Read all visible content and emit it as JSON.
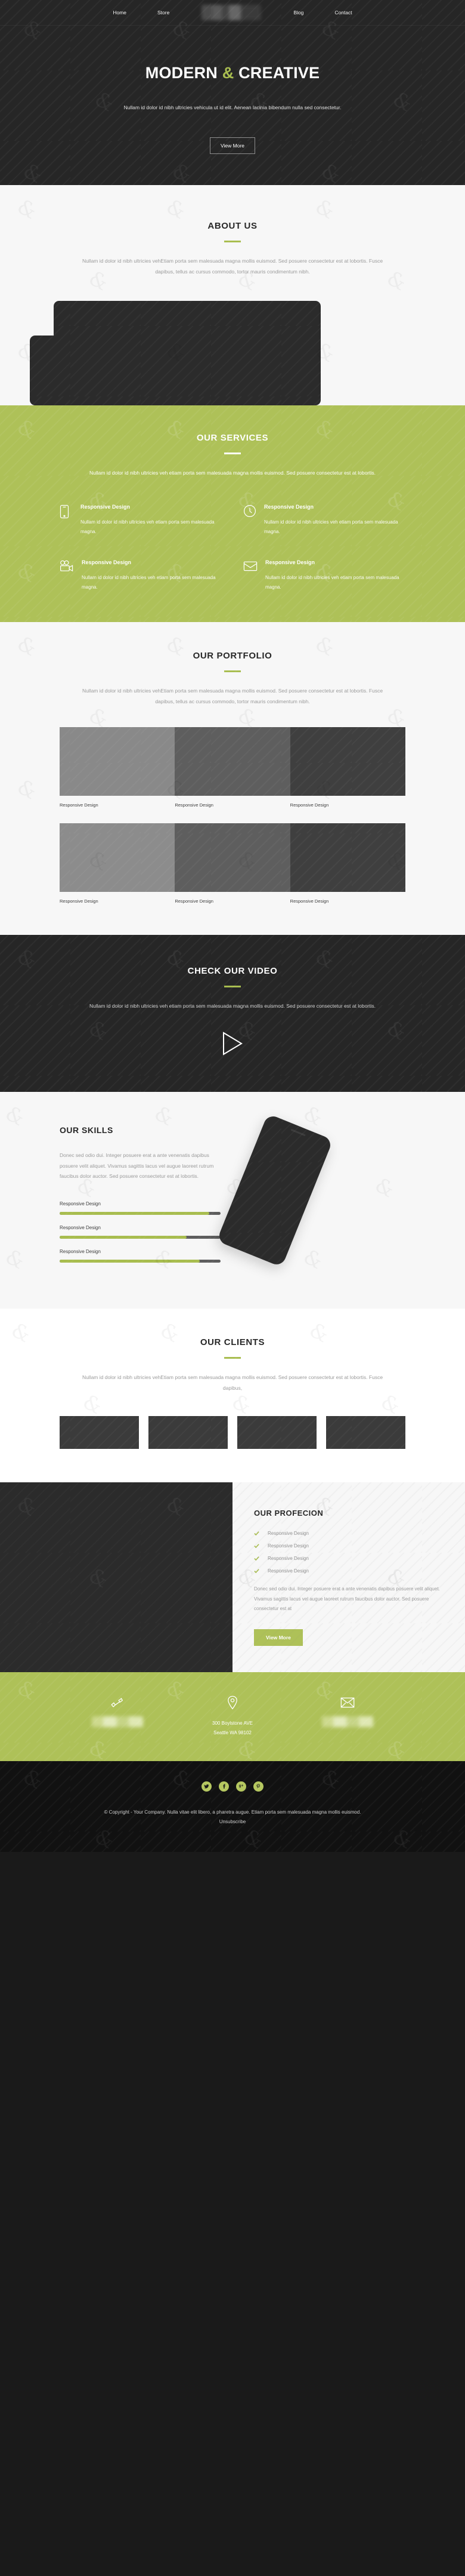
{
  "brand": {
    "accent": "#a8bd4f",
    "green_bg": "#aec158",
    "dark_bg": "#262626",
    "light_bg": "#f7f7f7"
  },
  "nav": {
    "left": [
      {
        "label": "Home"
      },
      {
        "label": "Store"
      }
    ],
    "right": [
      {
        "label": "Blog"
      },
      {
        "label": "Contact"
      }
    ],
    "logo_alt": "logo-blurred"
  },
  "hero": {
    "title_part1": "MODERN",
    "title_amp": "&",
    "title_part2": "CREATIVE",
    "subtitle": "Nullam id dolor id nibh ultricies vehicula ut id elit. Aenean lacinia bibendum nulla sed consectetur.",
    "cta": "View More"
  },
  "about": {
    "title": "ABOUT US",
    "body": "Nullam id dolor id nibh ultricies vehEtiam porta sem malesuada magna mollis euismod. Sed posuere consectetur est at lobortis. Fusce dapibus, tellus ac cursus commodo, tortor mauris condimentum nibh."
  },
  "services": {
    "title": "OUR SERVICES",
    "body": "Nullam id dolor id nibh ultricies veh etiam porta sem malesuada magna mollis euismod. Sed posuere consectetur est at lobortis.",
    "items": [
      {
        "icon": "mobile-icon",
        "heading": "Responsive Design",
        "text": "Nullam id dolor id nibh ultricies veh etiam porta sem malesuada magna."
      },
      {
        "icon": "clock-icon",
        "heading": "Responsive Design",
        "text": "Nullam id dolor id nibh ultricies veh etiam porta sem malesuada magna."
      },
      {
        "icon": "video-camera-icon",
        "heading": "Responsive Design",
        "text": "Nullam id dolor id nibh ultricies veh etiam porta sem malesuada magna."
      },
      {
        "icon": "envelope-icon",
        "heading": "Responsive Design",
        "text": "Nullam id dolor id nibh ultricies veh etiam porta sem malesuada magna."
      }
    ]
  },
  "portfolio": {
    "title": "OUR PORTFOLIO",
    "body": "Nullam id dolor id nibh ultricies vehEtiam porta sem malesuada magna mollis euismod. Sed posuere consectetur est at lobortis. Fusce dapibus, tellus ac cursus commodo, tortor mauris condimentum nibh.",
    "row1": [
      {
        "caption": "Responsive Design",
        "color": "#898989"
      },
      {
        "caption": "Responsive Design",
        "color": "#5e5e5e"
      },
      {
        "caption": "Responsive Design",
        "color": "#3f3f3f"
      }
    ],
    "row2": [
      {
        "caption": "Responsive Design",
        "color": "#8c8c8c"
      },
      {
        "caption": "Responsive Design",
        "color": "#5e5e5e"
      },
      {
        "caption": "Responsive Design",
        "color": "#3f3f3f"
      }
    ]
  },
  "video": {
    "title": "CHECK OUR VIDEO",
    "body": "Nullam id dolor id nibh ultricies veh etiam porta sem malesuada magna mollis euismod. Sed posuere consectetur est at lobortis.",
    "play_label": "play-button"
  },
  "skills": {
    "title": "OUR SKILLS",
    "body": "Donec sed odio dui. Integer posuere erat a ante venenatis dapibus posuere velit aliquet. Vivamus sagittis lacus vel augue laoreet rutrum faucibus dolor auctor. Sed posuere consectetur est at lobortis.",
    "bars": [
      {
        "label": "Responsive Design",
        "percent": 93
      },
      {
        "label": "Responsive Design",
        "percent": 79
      },
      {
        "label": "Responsive Design",
        "percent": 87
      }
    ]
  },
  "clients": {
    "title": "OUR CLIENTS",
    "body": "Nullam id dolor id nibh ultricies vehEtiam porta sem malesuada magna mollis euismod. Sed posuere consectetur est at lobortis. Fusce dapibus,",
    "logos": [
      {
        "name": "client-logo-1"
      },
      {
        "name": "client-logo-2"
      },
      {
        "name": "client-logo-3"
      },
      {
        "name": "client-logo-4"
      }
    ]
  },
  "profecion": {
    "title": "OUR PROFECION",
    "list": [
      {
        "label": "Responsive Design"
      },
      {
        "label": "Responsive Design"
      },
      {
        "label": "Responsive Design"
      },
      {
        "label": "Responsive Design"
      }
    ],
    "body": "Donec sed odio dui. Integer posuere erat a ante venenatis dapibus posuere velit aliquet. Vivamus sagittis lacus vel augue laoreet rutrum faucibus dolor auctor. Sed posuere consectetur est at",
    "cta": "View More"
  },
  "contact": {
    "phone": {
      "icon": "phone-icon",
      "value": ""
    },
    "address": {
      "icon": "location-pin-icon",
      "line1": "300 Boylstone AVE",
      "line2": "Seattle WA 98102"
    },
    "email": {
      "icon": "envelope-icon",
      "value": ""
    }
  },
  "footer": {
    "socials": [
      {
        "name": "twitter-icon",
        "glyph": "t"
      },
      {
        "name": "facebook-icon",
        "glyph": "f"
      },
      {
        "name": "google-plus-icon",
        "glyph": "g+"
      },
      {
        "name": "pinterest-icon",
        "glyph": "p"
      }
    ],
    "copyright": "© Copyright - Your Company. Nulla vitae elit libero, a pharetra augue. Etiam porta sem malesuada magna mollis euismod.",
    "unsubscribe": "Unsubscribe"
  }
}
